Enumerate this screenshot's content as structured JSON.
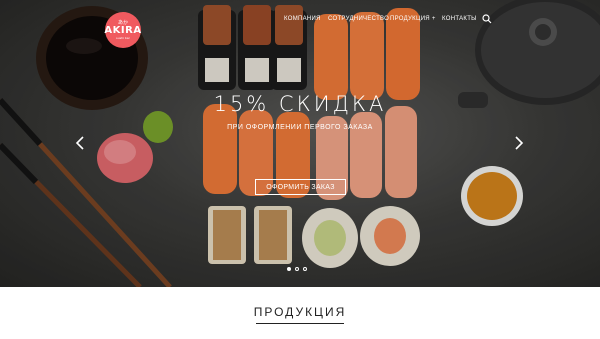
{
  "brand": {
    "logo_top": "あか",
    "logo_name": "AKIRA",
    "logo_sub": "sushi bar"
  },
  "nav": {
    "items": [
      "КОМПАНИЯ",
      "СОТРУДНИЧЕСТВО",
      "ПРОДУКЦИЯ +",
      "КОНТАКТЫ"
    ]
  },
  "icons": {
    "search": "search-icon",
    "prev": "chevron-left-icon",
    "next": "chevron-right-icon"
  },
  "hero": {
    "headline": "15% СКИДКА",
    "subtitle": "ПРИ ОФОРМЛЕНИИ ПЕРВОГО ЗАКАЗА",
    "cta_label": "ОФОРМИТЬ ЗАКАЗ",
    "slides": {
      "count": 3,
      "active": 1
    }
  },
  "section": {
    "title": "ПРОДУКЦИЯ"
  },
  "colors": {
    "accent": "#f05a5f",
    "salmon": "#f07a3a",
    "text_dark": "#222222"
  }
}
